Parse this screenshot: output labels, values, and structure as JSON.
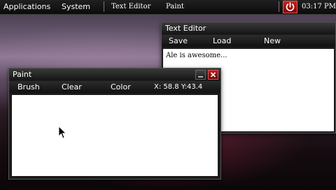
{
  "taskbar": {
    "applications": "Applications",
    "system": "System",
    "tasks": [
      "Text Editor",
      "Paint"
    ],
    "power_icon": "power-icon",
    "clock": "03:17 PM"
  },
  "text_editor": {
    "title": "Text Editor",
    "menu": [
      "Save",
      "Load",
      "New"
    ],
    "content": "Ale is awesome..."
  },
  "paint": {
    "title": "Paint",
    "menu": [
      "Brush",
      "Clear",
      "Color"
    ],
    "coords": "X: 58.8 Y:43.4",
    "minimize_icon": "minimize-icon",
    "close_icon": "close-icon"
  },
  "colors": {
    "close_red": "#b52020",
    "canvas": "#ffffff",
    "bar_dark": "#111111"
  }
}
